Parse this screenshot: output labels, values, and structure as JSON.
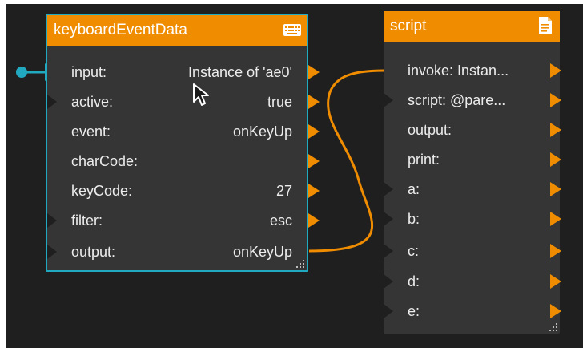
{
  "colors": {
    "header": "#f08c00",
    "port": "#f08c00",
    "selection": "#21a9c2",
    "node_body": "#353535",
    "canvas": "#1f1f1f"
  },
  "nodes": {
    "keyboard": {
      "title": "keyboardEventData",
      "icon": "keyboard-icon",
      "rows": [
        {
          "label": "input:",
          "value": "Instance of 'ae0'"
        },
        {
          "label": "active:",
          "value": "true"
        },
        {
          "label": "event:",
          "value": "onKeyUp"
        },
        {
          "label": "charCode:",
          "value": ""
        },
        {
          "label": "keyCode:",
          "value": "27"
        },
        {
          "label": "filter:",
          "value": "esc"
        },
        {
          "label": "output:",
          "value": "onKeyUp"
        }
      ]
    },
    "script": {
      "title": "script",
      "icon": "document-icon",
      "rows": [
        {
          "label": "invoke: Instan..."
        },
        {
          "label": "script: @pare..."
        },
        {
          "label": "output:"
        },
        {
          "label": "print:"
        },
        {
          "label": "a:"
        },
        {
          "label": "b:"
        },
        {
          "label": "c:"
        },
        {
          "label": "d:"
        },
        {
          "label": "e:"
        }
      ]
    }
  }
}
